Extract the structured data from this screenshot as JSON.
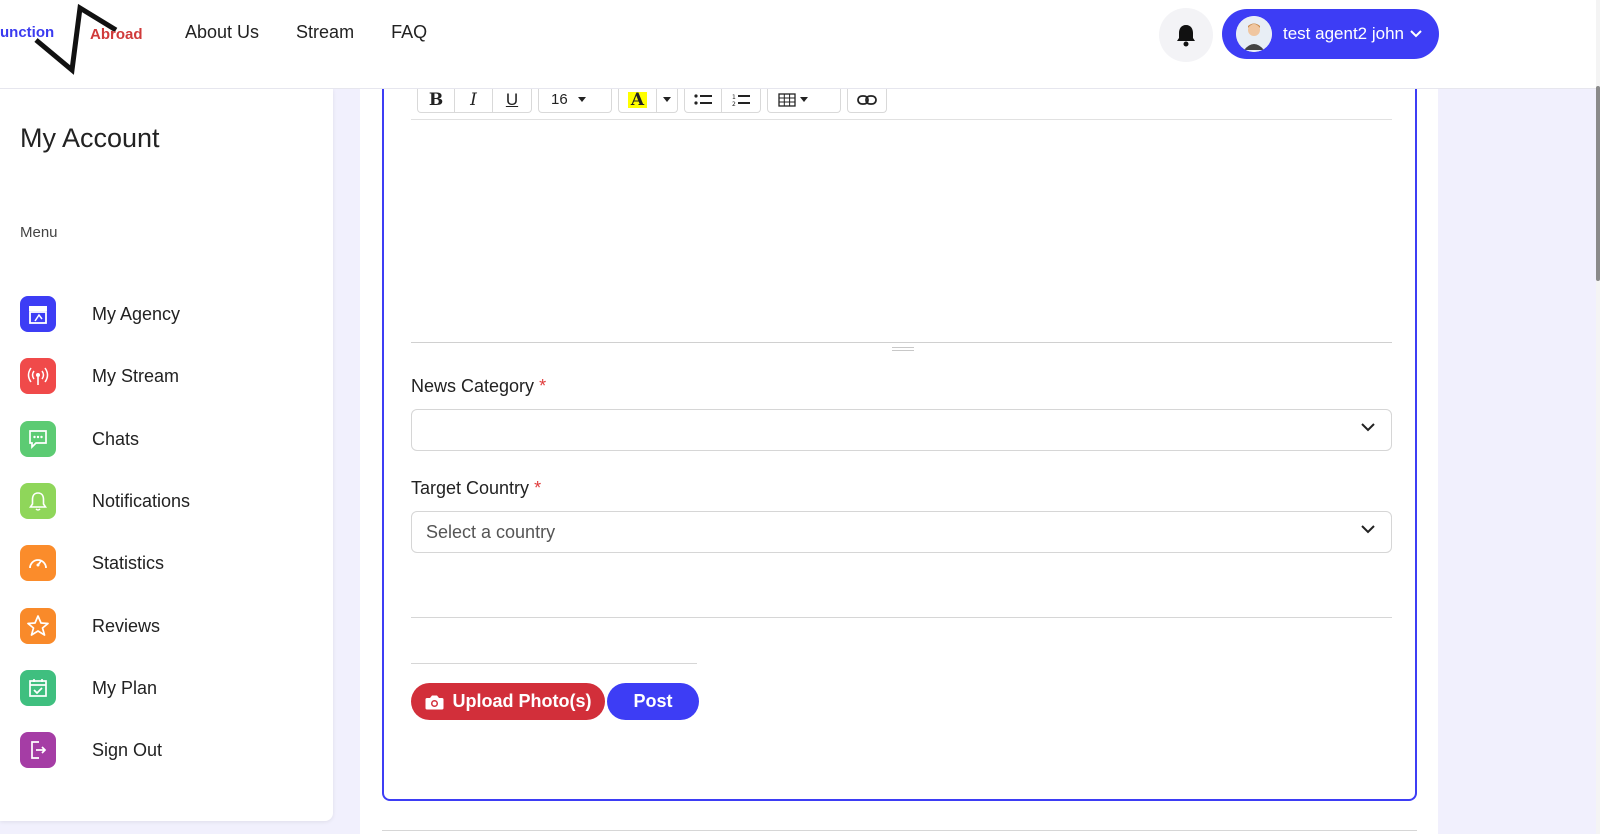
{
  "brand": {
    "logo_left": "unction",
    "logo_right": "Abroad"
  },
  "nav": [
    "About Us",
    "Stream",
    "FAQ"
  ],
  "user": {
    "name": "test agent2 john"
  },
  "sidebar": {
    "title": "My Account",
    "menu_label": "Menu",
    "items": [
      {
        "label": "My Agency",
        "icon": "storefront-icon",
        "color": "#3d3df5"
      },
      {
        "label": "My Stream",
        "icon": "broadcast-icon",
        "color": "#f04a4a"
      },
      {
        "label": "Chats",
        "icon": "chat-icon",
        "color": "#5ccb73"
      },
      {
        "label": "Notifications",
        "icon": "bell-icon",
        "color": "#8fd65a"
      },
      {
        "label": "Statistics",
        "icon": "gauge-icon",
        "color": "#fb8c2b"
      },
      {
        "label": "Reviews",
        "icon": "star-icon",
        "color": "#f98a2a"
      },
      {
        "label": "My Plan",
        "icon": "calendar-check-icon",
        "color": "#3fbf7f"
      },
      {
        "label": "Sign Out",
        "icon": "sign-out-icon",
        "color": "#a53da5"
      }
    ]
  },
  "editor": {
    "toolbar": {
      "bold": "B",
      "italic": "I",
      "underline": "U",
      "font_size": "16",
      "color_letter": "A"
    }
  },
  "form": {
    "news_category": {
      "label": "News Category",
      "required_mark": "*",
      "value": ""
    },
    "target_country": {
      "label": "Target Country",
      "required_mark": "*",
      "placeholder": "Select a country"
    },
    "upload_button": "Upload Photo(s)",
    "post_button": "Post"
  },
  "colors": {
    "primary": "#3d3df5",
    "danger": "#d22f3a"
  }
}
